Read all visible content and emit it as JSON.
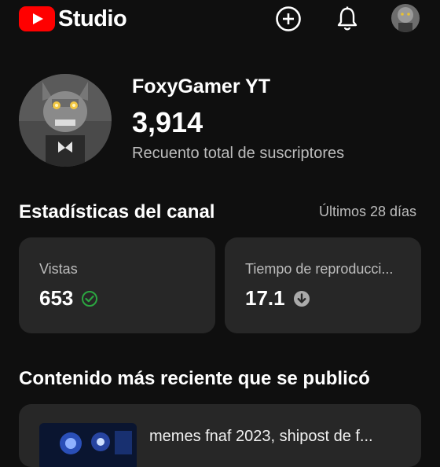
{
  "header": {
    "logo_text": "Studio",
    "icons": [
      "create-icon",
      "notifications-icon",
      "account-avatar"
    ],
    "brand_color": "#ff0000"
  },
  "channel": {
    "name": "FoxyGamer YT",
    "subscriber_count": "3,914",
    "subscriber_label": "Recuento total de suscriptores"
  },
  "stats": {
    "title": "Estadísticas del canal",
    "period": "Últimos 28 días",
    "cards": [
      {
        "label": "Vistas",
        "value": "653",
        "status_icon": "check-circle-icon",
        "status_color": "#2ba640"
      },
      {
        "label": "Tiempo de reproducci...",
        "value": "17.1",
        "status_icon": "arrow-down-circle-icon",
        "status_color": "#aaaaaa"
      }
    ]
  },
  "recent": {
    "title": "Contenido más reciente que se publicó",
    "video_title": "memes fnaf 2023, shipost de f..."
  }
}
